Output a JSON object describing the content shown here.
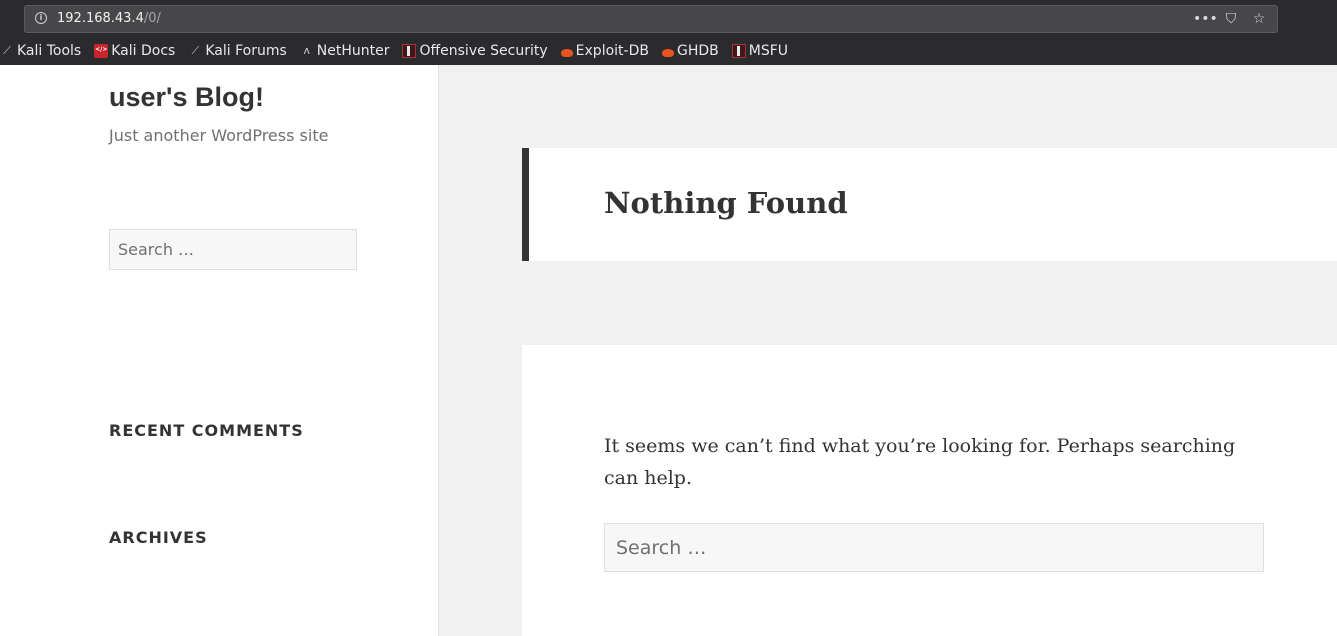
{
  "browser": {
    "url_host": "192.168.43.4",
    "url_path": "/0/",
    "actions": [
      {
        "icon": "more-icon",
        "glyph": "•••"
      },
      {
        "icon": "pocket-icon",
        "glyph": "⛉"
      },
      {
        "icon": "star-icon",
        "glyph": "☆"
      }
    ],
    "bookmarks": [
      {
        "label": "Kali Tools",
        "icon": "kali-dragon-icon"
      },
      {
        "label": "Kali Docs",
        "icon": "kali-docs-icon"
      },
      {
        "label": "Kali Forums",
        "icon": "kali-dragon-icon"
      },
      {
        "label": "NetHunter",
        "icon": "nethunter-icon"
      },
      {
        "label": "Offensive Security",
        "icon": "offsec-icon"
      },
      {
        "label": "Exploit-DB",
        "icon": "exploit-db-icon"
      },
      {
        "label": "GHDB",
        "icon": "exploit-db-icon"
      },
      {
        "label": "MSFU",
        "icon": "offsec-icon"
      }
    ]
  },
  "sidebar": {
    "site_title": "user's Blog!",
    "site_description": "Just another WordPress site",
    "search_placeholder": "Search …",
    "widgets": [
      "RECENT COMMENTS",
      "ARCHIVES"
    ]
  },
  "main": {
    "page_title": "Nothing Found",
    "message": "It seems we can’t find what you’re looking for. Perhaps searching can help.",
    "search_placeholder": "Search …"
  }
}
